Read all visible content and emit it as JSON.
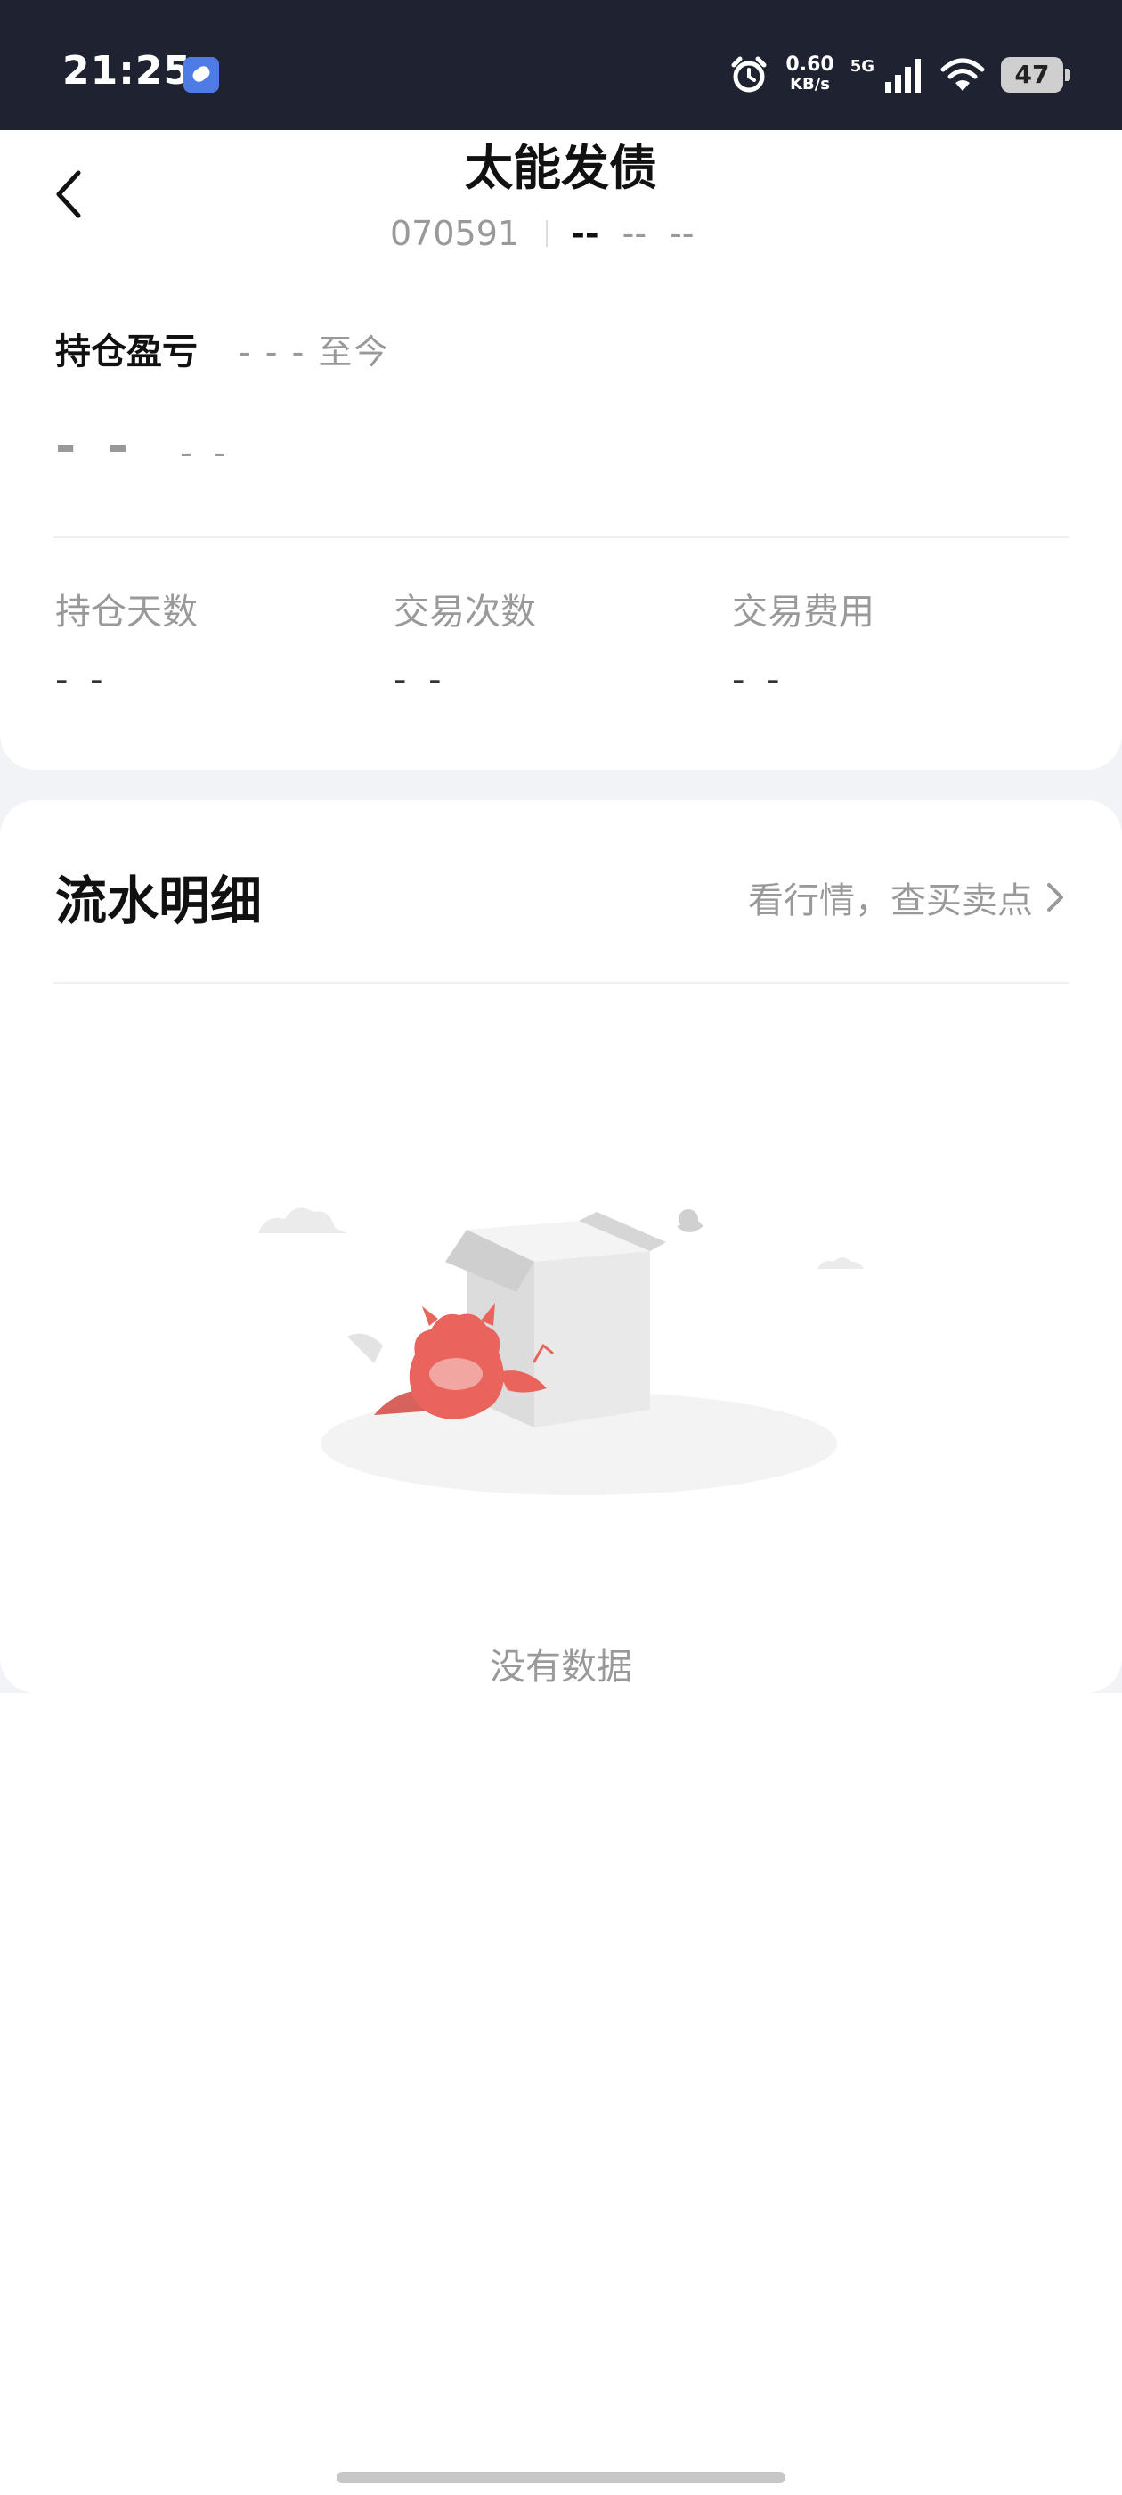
{
  "status_bar": {
    "time": "21:25",
    "net_speed_value": "0.60",
    "net_speed_unit": "KB/s",
    "network_type": "5G",
    "battery": "47",
    "icons": [
      "app-icon",
      "alarm-icon",
      "signal-icon",
      "wifi-icon",
      "battery-icon"
    ]
  },
  "header": {
    "title": "太能发债",
    "code": "070591",
    "dash1": "--",
    "dash2": "--",
    "dash3": "--"
  },
  "holding_pl": {
    "label": "持仓盈亏",
    "period": "- - - 至今",
    "value": "- -",
    "percent": "- -"
  },
  "stats": [
    {
      "label": "持仓天数",
      "value": "- -"
    },
    {
      "label": "交易次数",
      "value": "- -"
    },
    {
      "label": "交易费用",
      "value": "- -"
    }
  ],
  "flow": {
    "title": "流水明细",
    "link": "看行情，查买卖点",
    "empty_text": "没有数据"
  },
  "colors": {
    "status_bar_bg": "#1f2230",
    "page_bg": "#f2f3f7",
    "card_bg": "#ffffff",
    "muted_text": "#999999",
    "mascot": "#e8645c"
  }
}
